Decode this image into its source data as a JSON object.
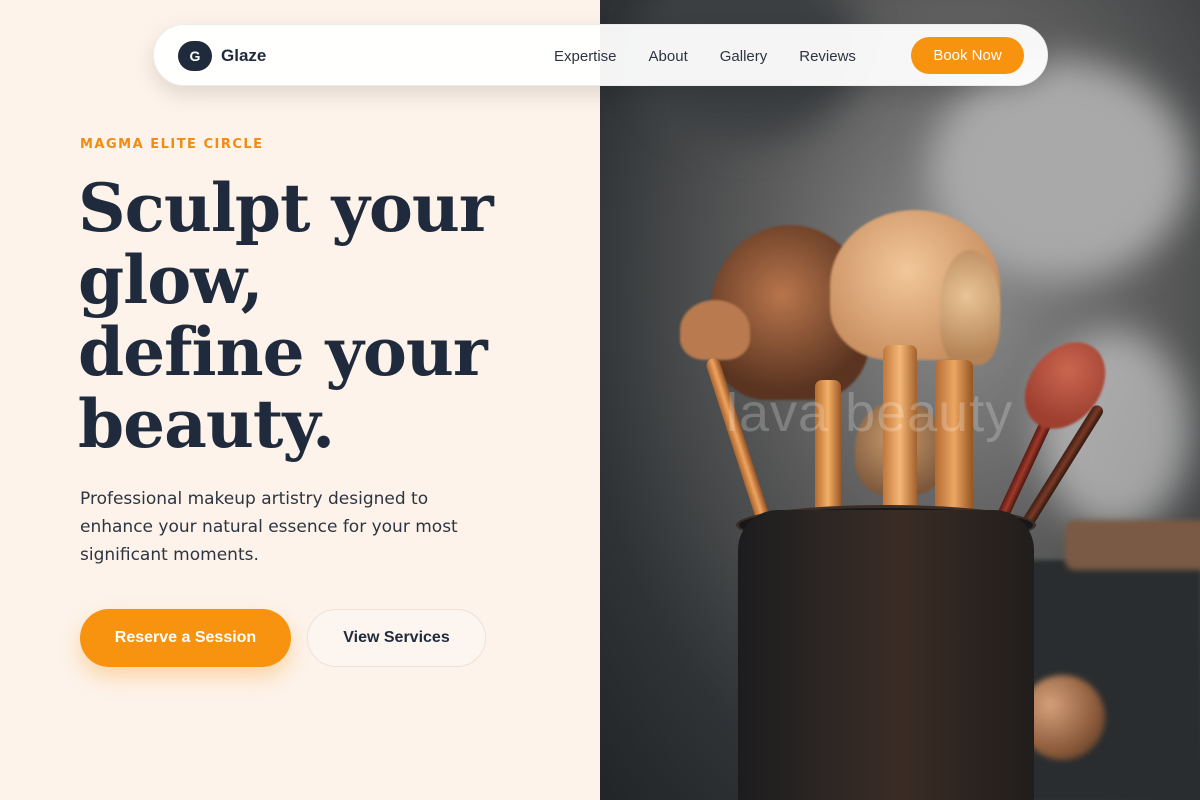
{
  "brand": {
    "logo_letter": "G",
    "name": "Glaze"
  },
  "nav": {
    "links": [
      "Expertise",
      "About",
      "Gallery",
      "Reviews"
    ],
    "cta": "Book Now"
  },
  "hero": {
    "eyebrow": "MAGMA ELITE CIRCLE",
    "headline_lines": [
      "Sculpt your",
      "glow,",
      "define your",
      "beauty."
    ],
    "subtext": "Professional makeup artistry designed to enhance your natural essence for your most significant moments.",
    "primary_cta": "Reserve a Session",
    "secondary_cta": "View Services"
  },
  "photo": {
    "subject": "makeup-brushes-in-cup",
    "watermark": "lava beauty"
  },
  "colors": {
    "accent": "#f7930f",
    "navy": "#1f2a3c",
    "cream": "#fdf3ea"
  }
}
